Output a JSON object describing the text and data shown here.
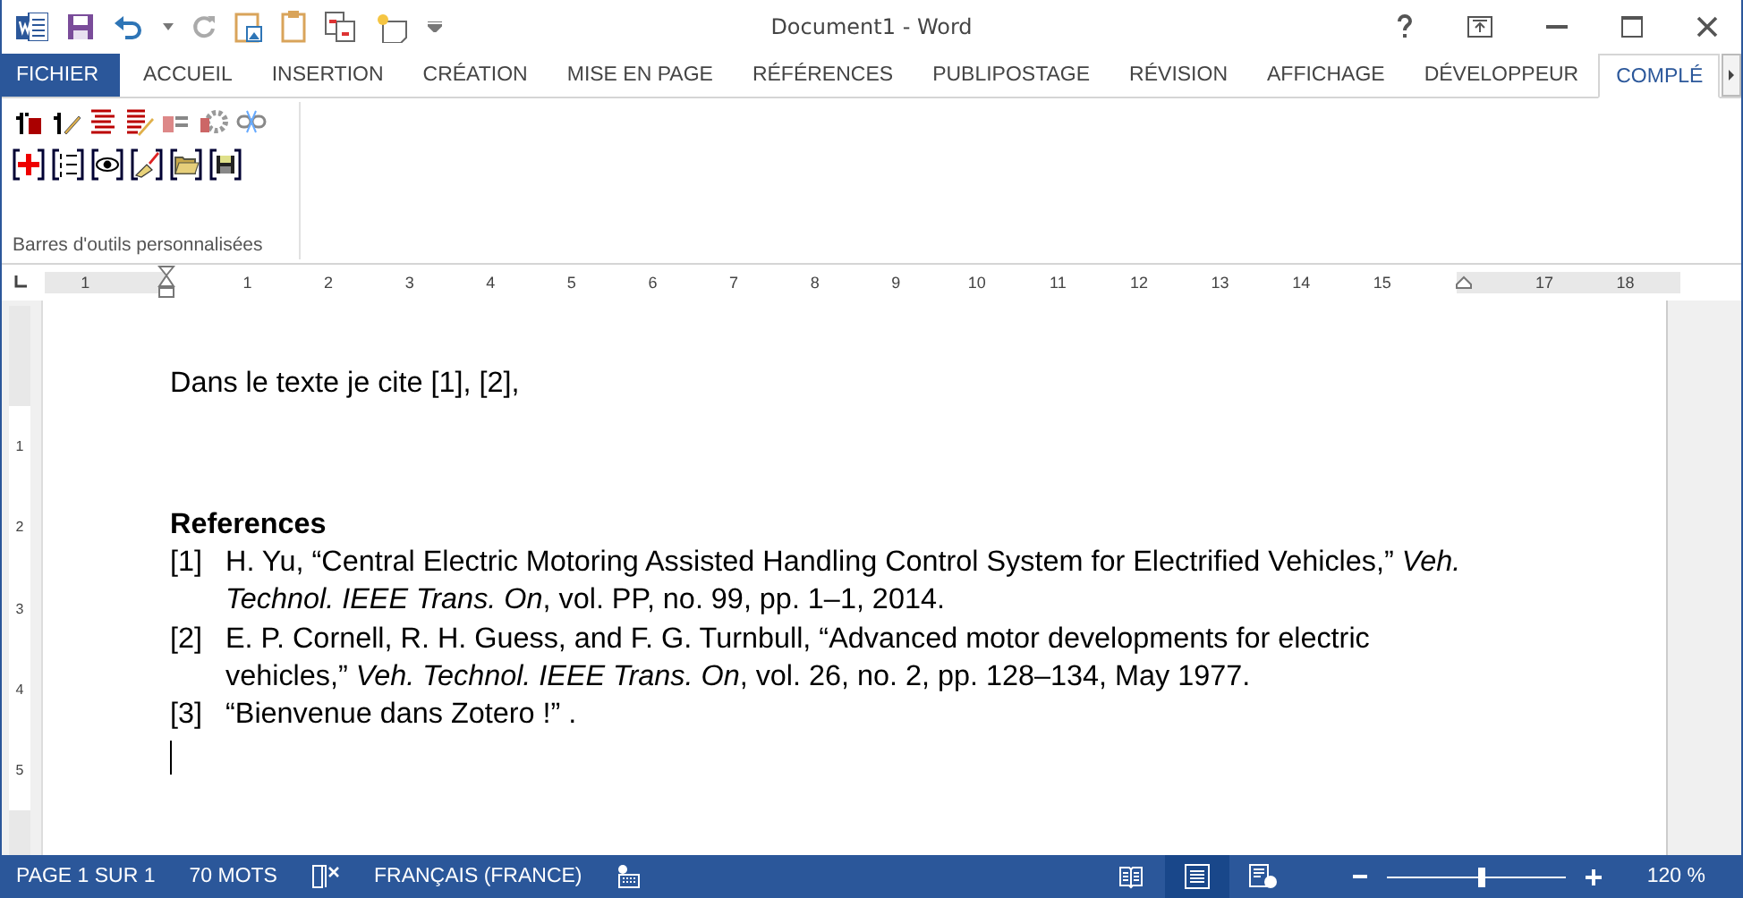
{
  "window": {
    "title": "Document1 - Word"
  },
  "tabs": [
    {
      "label": "FICHIER",
      "kind": "file",
      "selected": false
    },
    {
      "label": "ACCUEIL",
      "kind": "tab",
      "selected": false
    },
    {
      "label": "INSERTION",
      "kind": "tab",
      "selected": false
    },
    {
      "label": "CRÉATION",
      "kind": "tab",
      "selected": false
    },
    {
      "label": "MISE EN PAGE",
      "kind": "tab",
      "selected": false
    },
    {
      "label": "RÉFÉRENCES",
      "kind": "tab",
      "selected": false
    },
    {
      "label": "PUBLIPOSTAGE",
      "kind": "tab",
      "selected": false
    },
    {
      "label": "RÉVISION",
      "kind": "tab",
      "selected": false
    },
    {
      "label": "AFFICHAGE",
      "kind": "tab",
      "selected": false
    },
    {
      "label": "DÉVELOPPEUR",
      "kind": "tab",
      "selected": false
    },
    {
      "label": "COMPLÉ",
      "kind": "tab",
      "selected": true
    }
  ],
  "ribbon": {
    "group_label": "Barres d'outils personnalisées"
  },
  "ruler": [
    {
      "kind": "number",
      "text": "1"
    },
    {
      "kind": "indent-marker"
    },
    {
      "kind": "number",
      "text": "1"
    },
    {
      "kind": "number",
      "text": "2"
    },
    {
      "kind": "number",
      "text": "3"
    },
    {
      "kind": "number",
      "text": "4"
    },
    {
      "kind": "number",
      "text": "5"
    },
    {
      "kind": "number",
      "text": "6"
    },
    {
      "kind": "number",
      "text": "7"
    },
    {
      "kind": "number",
      "text": "8"
    },
    {
      "kind": "number",
      "text": "9"
    },
    {
      "kind": "number",
      "text": "10"
    },
    {
      "kind": "number",
      "text": "11"
    },
    {
      "kind": "number",
      "text": "12"
    },
    {
      "kind": "number",
      "text": "13"
    },
    {
      "kind": "number",
      "text": "14"
    },
    {
      "kind": "number",
      "text": "15"
    },
    {
      "kind": "right-marker"
    },
    {
      "kind": "number",
      "text": "17"
    },
    {
      "kind": "number",
      "text": "18"
    }
  ],
  "vertical_ruler": [
    "1",
    "2",
    "3",
    "4",
    "5"
  ],
  "document": {
    "intro": "Dans le texte je cite [1], [2],",
    "heading": "References",
    "references": [
      {
        "number": "[1]",
        "lines": [
          "H. Yu, “Central Electric Motoring Assisted Handling Control System for Electrified Vehicles,” *Veh.*",
          "*Technol. IEEE Trans. On*, vol. PP, no. 99, pp. 1–1, 2014."
        ]
      },
      {
        "number": "[2]",
        "lines": [
          "E. P. Cornell, R. H. Guess, and F. G. Turnbull, “Advanced motor developments for electric",
          "vehicles,” *Veh. Technol. IEEE Trans. On*, vol. 26, no. 2, pp. 128–134, May 1977."
        ]
      },
      {
        "number": "[3]",
        "lines": [
          "“Bienvenue dans Zotero !” ."
        ]
      }
    ]
  },
  "status_bar": {
    "page": "PAGE 1 SUR 1",
    "words": "70 MOTS",
    "language": "FRANÇAIS (FRANCE)",
    "views": [
      {
        "kind": "read",
        "selected": false
      },
      {
        "kind": "print",
        "selected": true
      },
      {
        "kind": "web",
        "selected": false
      }
    ],
    "zoom": {
      "level": 0.53,
      "reading": "120 %"
    }
  }
}
